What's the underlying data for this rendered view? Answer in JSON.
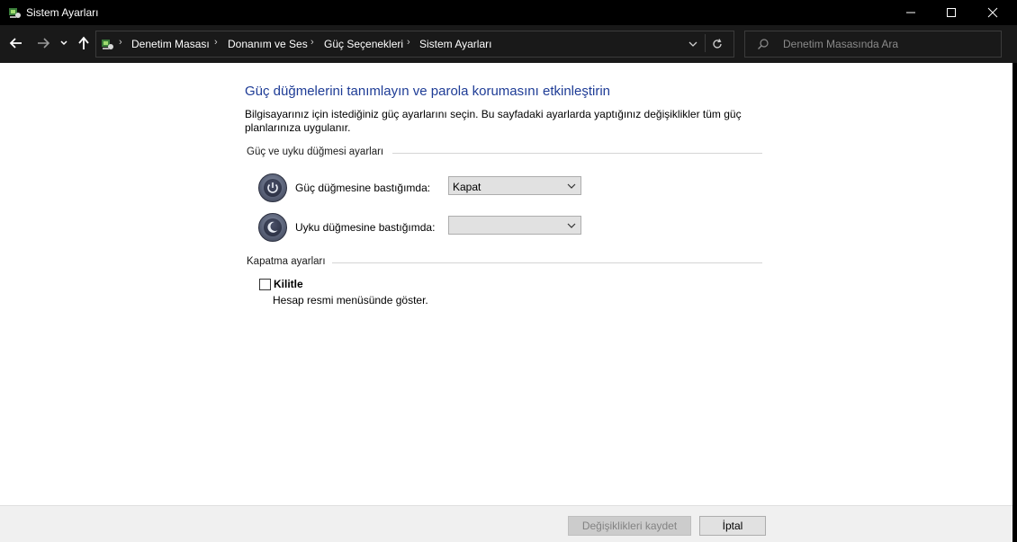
{
  "window": {
    "title": "Sistem Ayarları"
  },
  "address_bar": {
    "breadcrumbs": [
      "Denetim Masası",
      "Donanım ve Ses",
      "Güç Seçenekleri",
      "Sistem Ayarları"
    ],
    "search_placeholder": "Denetim Masasında Ara"
  },
  "main": {
    "heading": "Güç düğmelerini tanımlayın ve parola korumasını etkinleştirin",
    "description": "Bilgisayarınız için istediğiniz güç ayarlarını seçin. Bu sayfadaki ayarlarda yaptığınız değişiklikler tüm güç planlarınıza uygulanır.",
    "power_group": {
      "title": "Güç ve uyku düğmesi ayarları",
      "power_button": {
        "label": "Güç düğmesine bastığımda:",
        "value": "Kapat"
      },
      "sleep_button": {
        "label": "Uyku düğmesine bastığımda:",
        "value": ""
      }
    },
    "shutdown_group": {
      "title": "Kapatma ayarları",
      "lock": {
        "label": "Kilitle",
        "description": "Hesap resmi menüsünde göster.",
        "checked": false
      }
    }
  },
  "footer": {
    "save_label": "Değişiklikleri kaydet",
    "cancel_label": "İptal"
  }
}
